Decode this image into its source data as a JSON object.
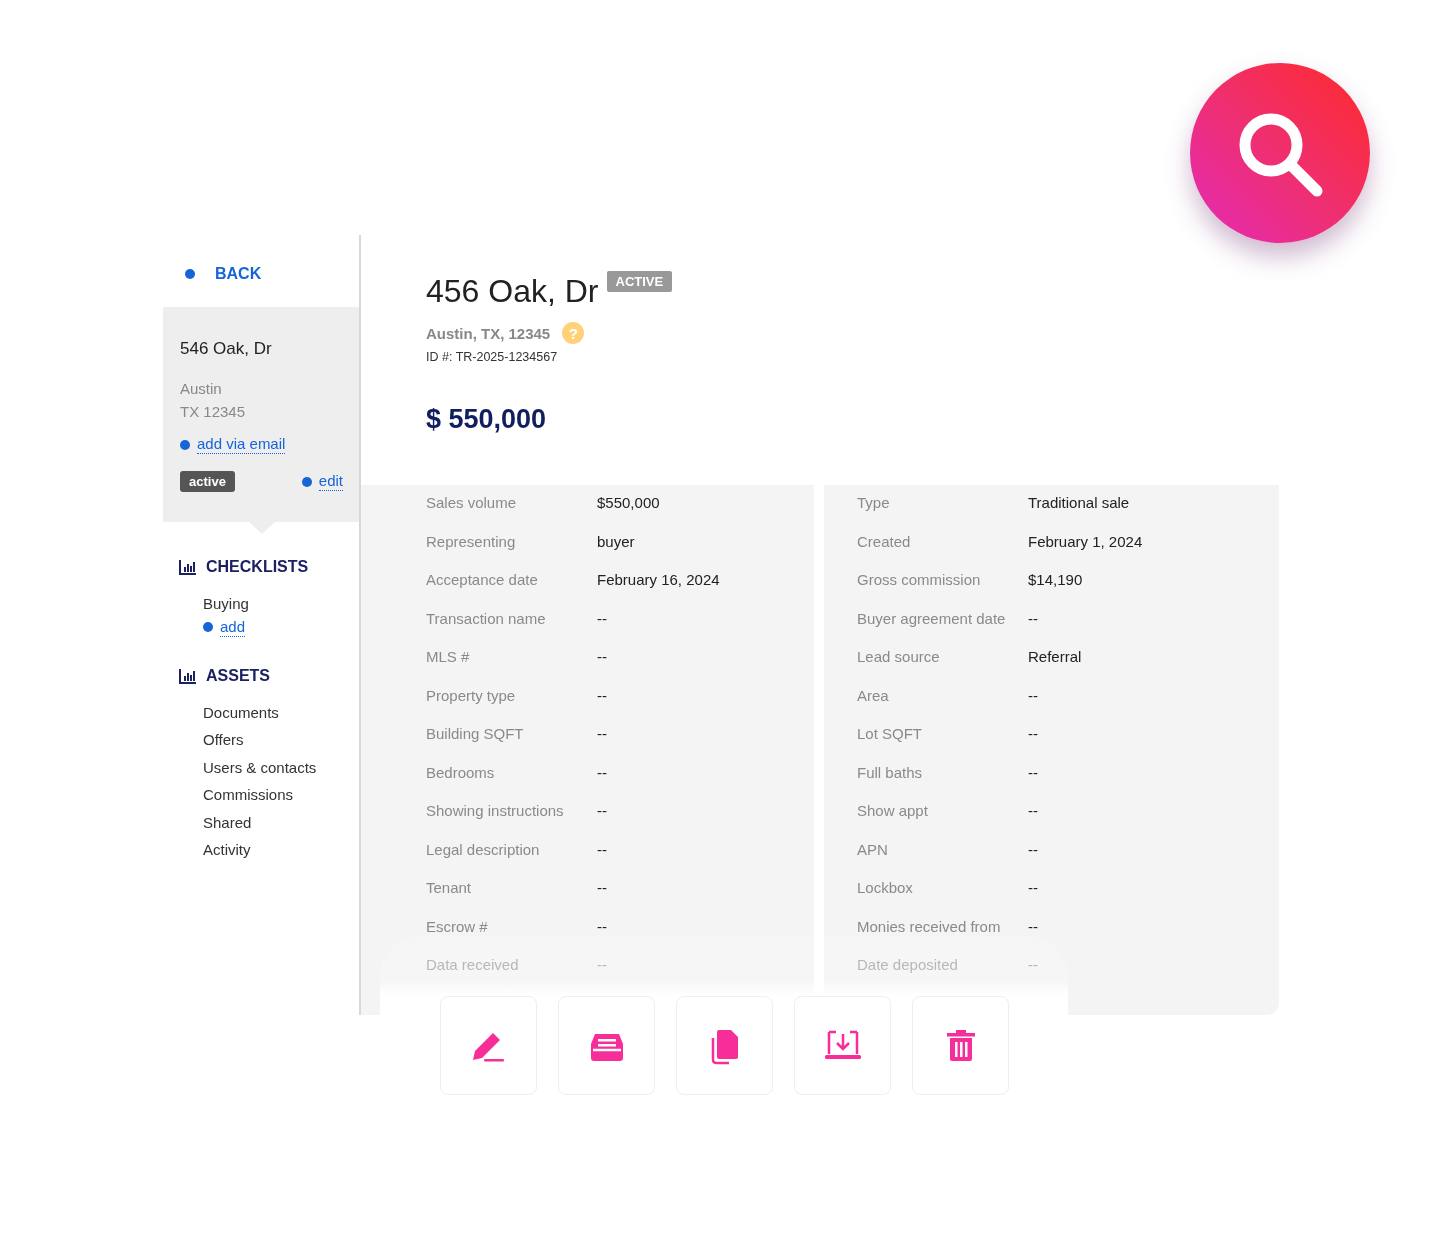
{
  "back": {
    "label": "BACK"
  },
  "card": {
    "title": "546 Oak, Dr",
    "city": "Austin",
    "state_zip": "TX 12345",
    "email_link": "add via email",
    "status": "active",
    "edit_link": "edit"
  },
  "sections": [
    {
      "title": "CHECKLISTS",
      "items": [
        {
          "label": "Buying",
          "kind": "item"
        },
        {
          "label": "add",
          "kind": "link"
        }
      ]
    },
    {
      "title": "ASSETS",
      "items": [
        {
          "label": "Documents",
          "kind": "item"
        },
        {
          "label": "Offers",
          "kind": "item"
        },
        {
          "label": "Users & contacts",
          "kind": "item"
        },
        {
          "label": "Commissions",
          "kind": "item"
        },
        {
          "label": "Shared",
          "kind": "item"
        },
        {
          "label": "Activity",
          "kind": "item"
        }
      ]
    }
  ],
  "header": {
    "title": "456 Oak, Dr",
    "badge": "ACTIVE",
    "location": "Austin, TX, 12345",
    "help": "?",
    "id": "ID #: TR-2025-1234567",
    "price": "$ 550,000"
  },
  "details": [
    {
      "fields": [
        {
          "label": "Sales volume",
          "value": "$550,000",
          "faded": false
        },
        {
          "label": "Representing",
          "value": "buyer",
          "faded": false
        },
        {
          "label": "Acceptance date",
          "value": "February 16, 2024",
          "faded": false
        },
        {
          "label": "Transaction name",
          "value": "--",
          "faded": false
        },
        {
          "label": "MLS #",
          "value": "--",
          "faded": false
        },
        {
          "label": "Property type",
          "value": "--",
          "faded": false
        },
        {
          "label": "Building SQFT",
          "value": "--",
          "faded": false
        },
        {
          "label": "Bedrooms",
          "value": "--",
          "faded": false
        },
        {
          "label": "Showing instructions",
          "value": "--",
          "faded": false
        },
        {
          "label": "Legal description",
          "value": "--",
          "faded": false
        },
        {
          "label": "Tenant",
          "value": "--",
          "faded": false
        },
        {
          "label": "Escrow #",
          "value": "--",
          "faded": false
        },
        {
          "label": "Data received",
          "value": "--",
          "faded": true
        }
      ]
    },
    {
      "fields": [
        {
          "label": "Type",
          "value": "Traditional sale",
          "faded": false
        },
        {
          "label": "Created",
          "value": "February 1, 2024",
          "faded": false
        },
        {
          "label": "Gross commission",
          "value": "$14,190",
          "faded": false
        },
        {
          "label": "Buyer agreement date",
          "value": "--",
          "faded": false
        },
        {
          "label": "Lead source",
          "value": "Referral",
          "faded": false
        },
        {
          "label": "Area",
          "value": "--",
          "faded": false
        },
        {
          "label": "Lot SQFT",
          "value": "--",
          "faded": false
        },
        {
          "label": "Full baths",
          "value": "--",
          "faded": false
        },
        {
          "label": "Show appt",
          "value": "--",
          "faded": false
        },
        {
          "label": "APN",
          "value": "--",
          "faded": false
        },
        {
          "label": "Lockbox",
          "value": "--",
          "faded": false
        },
        {
          "label": "Monies received from",
          "value": "--",
          "faded": false
        },
        {
          "label": "Date deposited",
          "value": "--",
          "faded": true
        }
      ]
    }
  ],
  "actions": [
    {
      "kind": "edit"
    },
    {
      "kind": "archive"
    },
    {
      "kind": "copy"
    },
    {
      "kind": "download"
    },
    {
      "kind": "delete"
    }
  ]
}
